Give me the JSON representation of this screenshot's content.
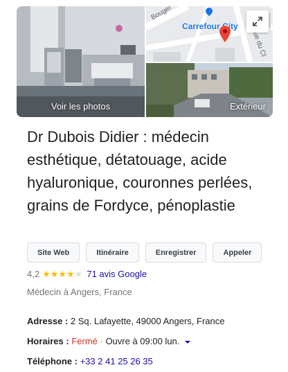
{
  "gallery": {
    "photos_label": "Voir les photos",
    "exterior_label": "Extérieur",
    "map_poi": "Carrefour City",
    "map_street_a": "Bouger",
    "map_street_b": "Rue du Cl"
  },
  "title": "Dr Dubois Didier : médecin esthétique, détatouage, acide hyaluronique, couronnes perlées, grains de Fordyce, pénoplastie",
  "actions": {
    "website": "Site Web",
    "directions": "Itinéraire",
    "save": "Enregistrer",
    "call": "Appeler"
  },
  "rating": {
    "value": "4,2",
    "stars": 4.2,
    "reviews": "71 avis Google"
  },
  "category": "Médecin à Angers, France",
  "address": {
    "label": "Adresse",
    "sep": " : ",
    "value": "2 Sq. Lafayette, 49000 Angers, France"
  },
  "hours": {
    "label": "Horaires",
    "sep": " : ",
    "status": "Fermé",
    "dot": " · ",
    "next": "Ouvre à 09:00 lun."
  },
  "phone": {
    "label": "Téléphone",
    "sep": " : ",
    "value": "+33 2 41 25 26 35"
  },
  "colors": {
    "star_filled": "#fbbc04",
    "star_empty": "#dadce0",
    "closed": "#d93025",
    "link": "#1a0dab",
    "pin": "#ea4335"
  }
}
